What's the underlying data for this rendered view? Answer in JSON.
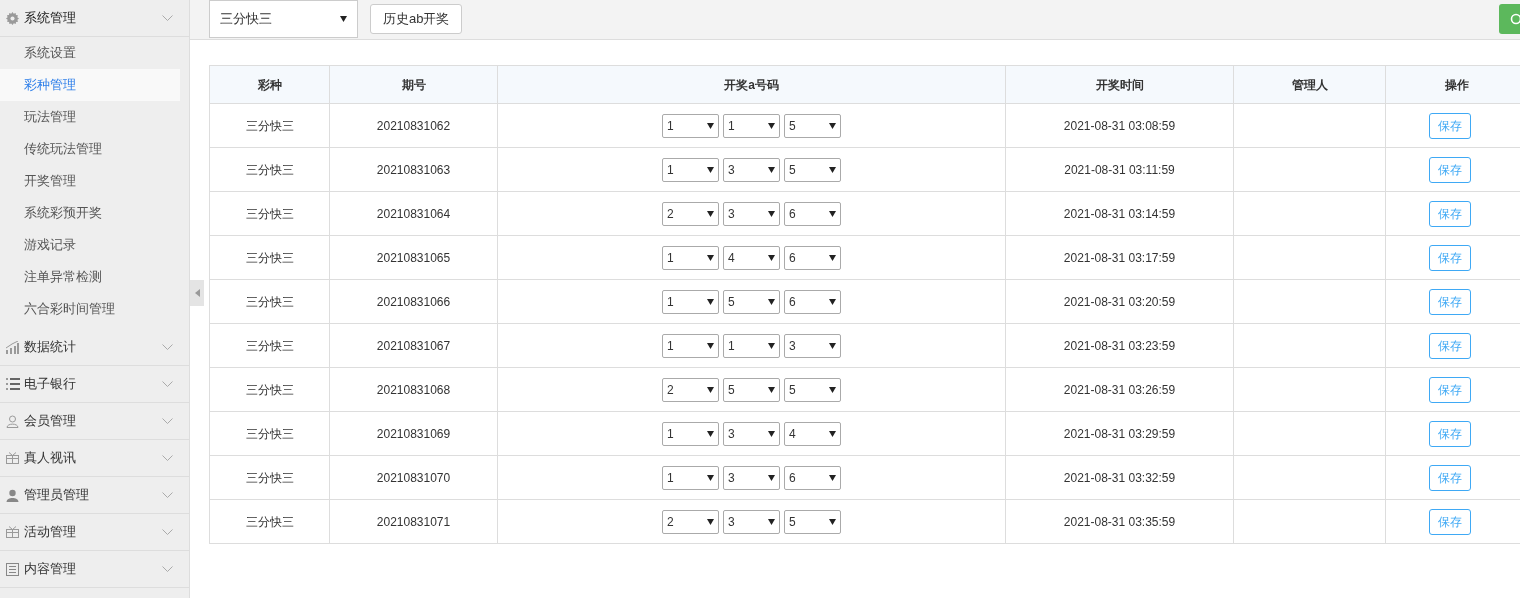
{
  "sidebar": {
    "groups": [
      {
        "label": "系统管理",
        "kind": "gear",
        "expanded": true,
        "items": [
          {
            "label": "系统设置",
            "selected": false
          },
          {
            "label": "彩种管理",
            "selected": true
          },
          {
            "label": "玩法管理",
            "selected": false
          },
          {
            "label": "传统玩法管理",
            "selected": false
          },
          {
            "label": "开奖管理",
            "selected": false
          },
          {
            "label": "系统彩预开奖",
            "selected": false
          },
          {
            "label": "游戏记录",
            "selected": false
          },
          {
            "label": "注单异常检测",
            "selected": false
          },
          {
            "label": "六合彩时间管理",
            "selected": false
          }
        ]
      },
      {
        "label": "数据统计",
        "kind": "chart",
        "expanded": false
      },
      {
        "label": "电子银行",
        "kind": "list",
        "expanded": false
      },
      {
        "label": "会员管理",
        "kind": "member",
        "expanded": false
      },
      {
        "label": "真人视讯",
        "kind": "gift",
        "expanded": false
      },
      {
        "label": "管理员管理",
        "kind": "admin",
        "expanded": false
      },
      {
        "label": "活动管理",
        "kind": "gift",
        "expanded": false
      },
      {
        "label": "内容管理",
        "kind": "content",
        "expanded": false
      }
    ]
  },
  "toolbar": {
    "lottery_select": "三分快三",
    "history_button": "历史ab开奖"
  },
  "table": {
    "columns": [
      "彩种",
      "期号",
      "开奖a号码",
      "开奖时间",
      "管理人",
      "操作"
    ],
    "rows": [
      {
        "lottery": "三分快三",
        "issue": "20210831062",
        "numbers": [
          "1",
          "1",
          "5"
        ],
        "time": "2021-08-31 03:08:59",
        "action": "保存"
      },
      {
        "lottery": "三分快三",
        "issue": "20210831063",
        "numbers": [
          "1",
          "3",
          "5"
        ],
        "time": "2021-08-31 03:11:59",
        "action": "保存"
      },
      {
        "lottery": "三分快三",
        "issue": "20210831064",
        "numbers": [
          "2",
          "3",
          "6"
        ],
        "time": "2021-08-31 03:14:59",
        "action": "保存"
      },
      {
        "lottery": "三分快三",
        "issue": "20210831065",
        "numbers": [
          "1",
          "4",
          "6"
        ],
        "time": "2021-08-31 03:17:59",
        "action": "保存"
      },
      {
        "lottery": "三分快三",
        "issue": "20210831066",
        "numbers": [
          "1",
          "5",
          "6"
        ],
        "time": "2021-08-31 03:20:59",
        "action": "保存"
      },
      {
        "lottery": "三分快三",
        "issue": "20210831067",
        "numbers": [
          "1",
          "1",
          "3"
        ],
        "time": "2021-08-31 03:23:59",
        "action": "保存"
      },
      {
        "lottery": "三分快三",
        "issue": "20210831068",
        "numbers": [
          "2",
          "5",
          "5"
        ],
        "time": "2021-08-31 03:26:59",
        "action": "保存"
      },
      {
        "lottery": "三分快三",
        "issue": "20210831069",
        "numbers": [
          "1",
          "3",
          "4"
        ],
        "time": "2021-08-31 03:29:59",
        "action": "保存"
      },
      {
        "lottery": "三分快三",
        "issue": "20210831070",
        "numbers": [
          "1",
          "3",
          "6"
        ],
        "time": "2021-08-31 03:32:59",
        "action": "保存"
      },
      {
        "lottery": "三分快三",
        "issue": "20210831071",
        "numbers": [
          "2",
          "3",
          "5"
        ],
        "time": "2021-08-31 03:35:59",
        "action": "保存"
      }
    ]
  }
}
